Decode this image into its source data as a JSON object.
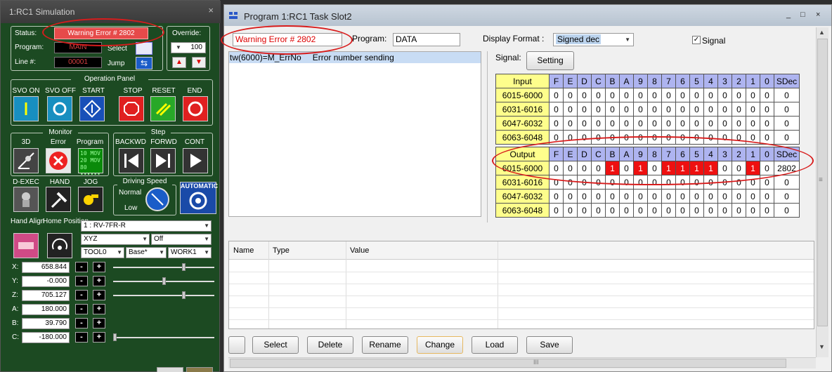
{
  "sim": {
    "title": "1:RC1  Simulation",
    "close": "×",
    "status_label": "Status:",
    "status_value": "Warning Error # 2802",
    "program_label": "Program:",
    "program_value": "MAIN",
    "select_label": "Select",
    "line_label": "Line #:",
    "line_value": "00001",
    "jump_label": "Jump",
    "override_label": "Override:",
    "override_value": "100",
    "operation_panel": "Operation Panel",
    "op_buttons": [
      "SVO ON",
      "SVO OFF",
      "START",
      "STOP",
      "RESET",
      "END"
    ],
    "monitor_label": "Monitor",
    "monitor_items": [
      "3D",
      "Error",
      "Program"
    ],
    "monitor_prog_icon": [
      "10 MOV",
      "20 MOV",
      "80 ••••••"
    ],
    "step_label": "Step",
    "step_items": [
      "BACKWD",
      "FORWD",
      "CONT"
    ],
    "dexec_label": "D-EXEC",
    "hand_label": "HAND",
    "jog_label": "JOG",
    "driving_label": "Driving Speed",
    "normal_label": "Normal",
    "low_label": "Low",
    "automatic_label": "AUTOMATIC",
    "hand_align_label": "Hand Align",
    "home_pos_label": "Home Position",
    "robot_select": "1 : RV-7FR-R",
    "frame_select": "XYZ",
    "off_select": "Off",
    "tool_select": "TOOL0",
    "base_select": "Base*",
    "work_select": "WORK1",
    "coords": [
      {
        "label": "X:",
        "value": "658.844",
        "slider": 0.7
      },
      {
        "label": "Y:",
        "value": "-0.000",
        "slider": 0.5
      },
      {
        "label": "Z:",
        "value": "705.127",
        "slider": 0.7
      },
      {
        "label": "A:",
        "value": "180.000"
      },
      {
        "label": "B:",
        "value": "39.790"
      },
      {
        "label": "C:",
        "value": "-180.000",
        "slider": 0.0
      }
    ],
    "minus": "-",
    "plus": "+"
  },
  "prog": {
    "title": "Program 1:RC1 Task Slot2",
    "title_buttons": [
      "_",
      "□",
      "×"
    ],
    "status_value": "Warning Error # 2802",
    "program_label": "Program:",
    "program_value": "DATA",
    "display_format_label": "Display Format :",
    "display_format_value": "Signed dec",
    "signal_checkbox_label": "Signal",
    "code_line_cmd": "tw(6000)=M_ErrNo",
    "code_line_comment": "Error number sending",
    "signal_label": "Signal:",
    "setting_button": "Setting",
    "bit_headers": [
      "F",
      "E",
      "D",
      "C",
      "B",
      "A",
      "9",
      "8",
      "7",
      "6",
      "5",
      "4",
      "3",
      "2",
      "1",
      "0"
    ],
    "sdec_header": "SDec",
    "input_header": "Input",
    "input_rows": [
      {
        "range": "6015-6000",
        "bits": [
          0,
          0,
          0,
          0,
          0,
          0,
          0,
          0,
          0,
          0,
          0,
          0,
          0,
          0,
          0,
          0
        ],
        "sdec": "0"
      },
      {
        "range": "6031-6016",
        "bits": [
          0,
          0,
          0,
          0,
          0,
          0,
          0,
          0,
          0,
          0,
          0,
          0,
          0,
          0,
          0,
          0
        ],
        "sdec": "0"
      },
      {
        "range": "6047-6032",
        "bits": [
          0,
          0,
          0,
          0,
          0,
          0,
          0,
          0,
          0,
          0,
          0,
          0,
          0,
          0,
          0,
          0
        ],
        "sdec": "0"
      },
      {
        "range": "6063-6048",
        "bits": [
          0,
          0,
          0,
          0,
          0,
          0,
          0,
          0,
          0,
          0,
          0,
          0,
          0,
          0,
          0,
          0
        ],
        "sdec": "0"
      }
    ],
    "output_header": "Output",
    "output_rows": [
      {
        "range": "6015-6000",
        "bits": [
          0,
          0,
          0,
          0,
          1,
          0,
          1,
          0,
          1,
          1,
          1,
          1,
          0,
          0,
          1,
          0
        ],
        "sdec": "2802"
      },
      {
        "range": "6031-6016",
        "bits": [
          0,
          0,
          0,
          0,
          0,
          0,
          0,
          0,
          0,
          0,
          0,
          0,
          0,
          0,
          0,
          0
        ],
        "sdec": "0"
      },
      {
        "range": "6047-6032",
        "bits": [
          0,
          0,
          0,
          0,
          0,
          0,
          0,
          0,
          0,
          0,
          0,
          0,
          0,
          0,
          0,
          0
        ],
        "sdec": "0"
      },
      {
        "range": "6063-6048",
        "bits": [
          0,
          0,
          0,
          0,
          0,
          0,
          0,
          0,
          0,
          0,
          0,
          0,
          0,
          0,
          0,
          0
        ],
        "sdec": "0"
      }
    ],
    "var_columns": [
      "Name",
      "Type",
      "Value"
    ],
    "bottom_buttons": [
      "Select",
      "Delete",
      "Rename",
      "Change",
      "Load",
      "Save"
    ],
    "scroll_up": "▲",
    "scroll_down": "▼",
    "scroll_mid": "≡",
    "hscroll_mid": "III",
    "colors": {
      "on_bit": "#ee1010",
      "header_bg": "#aeb4f0",
      "range_bg": "#fefe8c",
      "annotation": "#d81c1c"
    }
  }
}
